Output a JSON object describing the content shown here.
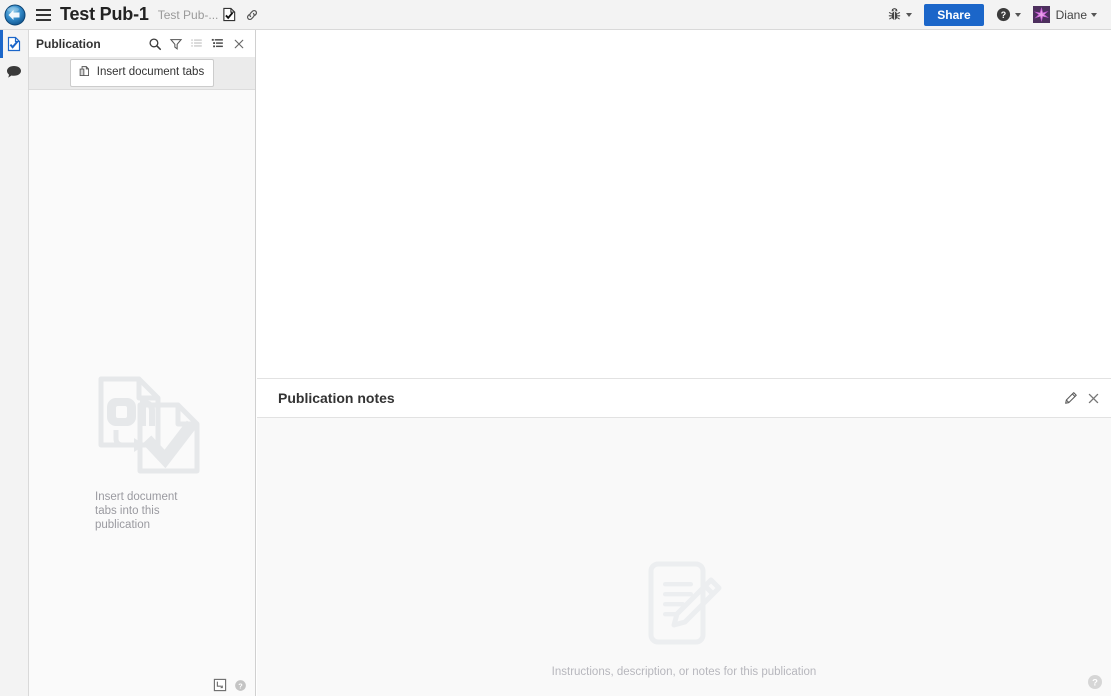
{
  "topbar": {
    "logo_icon": "app-logo-icon",
    "menu_icon": "hamburger-menu-icon",
    "title": "Test Pub-1",
    "subtitle": "Test Pub-...",
    "doc_check_icon": "document-check-icon",
    "link_icon": "link-icon",
    "bug_icon": "bug-icon",
    "share_label": "Share",
    "help_icon": "help-circle-icon",
    "avatar_icon": "user-avatar",
    "user_name": "Diane"
  },
  "rail": {
    "items": [
      {
        "name": "publication-panel",
        "icon": "document-check-icon",
        "active": true
      },
      {
        "name": "comments-panel",
        "icon": "comment-bubble-icon",
        "active": false
      }
    ]
  },
  "sidebar": {
    "title": "Publication",
    "toolbar_icons": [
      {
        "name": "search-icon",
        "label": "Search"
      },
      {
        "name": "filter-icon",
        "label": "Filter"
      },
      {
        "name": "list-view-icon",
        "label": "List view"
      },
      {
        "name": "tree-view-icon",
        "label": "Tree view"
      },
      {
        "name": "close-icon",
        "label": "Close"
      }
    ],
    "insert_button": {
      "label": "Insert document tabs",
      "icon": "insert-document-icon"
    },
    "empty_state": {
      "icon": "insert-documents-illustration",
      "text": "Insert document tabs into this publication"
    },
    "footer_icons": [
      {
        "name": "panel-layout-icon",
        "label": "Panel layout"
      },
      {
        "name": "help-icon",
        "label": "Help"
      }
    ]
  },
  "notes": {
    "title": "Publication notes",
    "edit_icon": "pencil-edit-icon",
    "close_icon": "close-icon",
    "empty_icon": "notes-pencil-illustration",
    "empty_text": "Instructions, description, or notes for this publication"
  },
  "footer": {
    "help_icon": "help-circle-icon"
  },
  "colors": {
    "accent": "#1b66c9",
    "topbar_bg": "#f3f3f3",
    "sidebar_bg": "#fafafa",
    "notes_bg": "#f9f9f9",
    "muted_text": "#9a9aa0"
  }
}
